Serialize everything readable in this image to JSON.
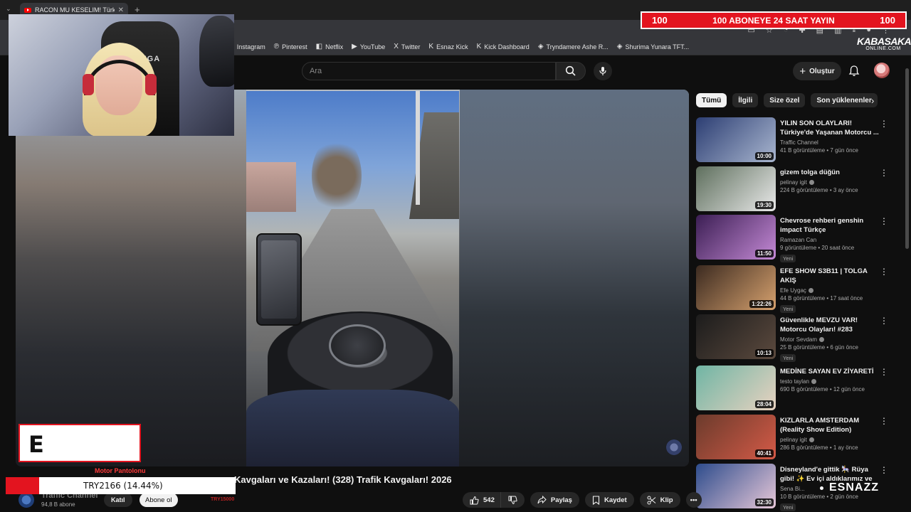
{
  "browser": {
    "tab_title": "RACON MU KESELIM! Türkiye'd",
    "new_tab_label": "+",
    "bookmarks": [
      {
        "label": "Instagram",
        "icon": "◎"
      },
      {
        "label": "Pinterest",
        "icon": "℗"
      },
      {
        "label": "Netflix",
        "icon": "◧"
      },
      {
        "label": "YouTube",
        "icon": "▶"
      },
      {
        "label": "Twitter",
        "icon": "X"
      },
      {
        "label": "Esnaz Kick",
        "icon": "K"
      },
      {
        "label": "Kick Dashboard",
        "icon": "K"
      },
      {
        "label": "Tryndamere Ashe R...",
        "icon": "◈"
      },
      {
        "label": "Shurima Yunara TFT...",
        "icon": "◈"
      }
    ]
  },
  "header": {
    "search_placeholder": "Ara",
    "create_label": "Oluştur"
  },
  "overlay": {
    "sub_left": "100",
    "sub_center": "100 ABONEYE 24 SAAT YAYIN",
    "sub_right": "100",
    "brand_top": "KABASAKAL",
    "brand_bottom": "ONLINE.COM",
    "chair_brand": "VEGA",
    "promo_letter": "E",
    "motor_label": "Motor Pantolonu",
    "try_text": "TRY2166 (14.44%)",
    "try_progress": 0.1444,
    "try_small": "TRY15000",
    "esnazz": "ESNAZZ"
  },
  "video": {
    "title": "Kavgaları ve Kazaları! (328) Trafik Kavgaları! 2026",
    "channel_name": "Traffic Channel",
    "channel_subs": "94,8 B abone",
    "join_label": "Katıl",
    "subscribe_label": "Abone ol",
    "likes": "542",
    "share_label": "Paylaş",
    "save_label": "Kaydet",
    "clip_label": "Klip"
  },
  "chips": [
    "Tümü",
    "İlgili",
    "Size özel",
    "Son yüklenenler"
  ],
  "related": [
    {
      "title": "YILIN SON OLAYLARI! Türkiye'de Yaşanan Motorcu ...",
      "channel": "Traffic Channel",
      "verified": false,
      "stats": "41 B görüntüleme • 7 gün önce",
      "duration": "10:00",
      "badge": "",
      "thumb_colors": [
        "#2c3e73",
        "#a9b6cf"
      ]
    },
    {
      "title": "gizem tolga düğün",
      "channel": "pelinay igit",
      "verified": true,
      "stats": "224 B görüntüleme • 3 ay önce",
      "duration": "19:30",
      "badge": "",
      "thumb_colors": [
        "#5e6f5d",
        "#e9e9e9"
      ]
    },
    {
      "title": "Chevrose rehberi genshin impact Türkçe",
      "channel": "Ramazan Can",
      "verified": false,
      "stats": "9 görüntüleme • 20 saat önce",
      "duration": "11:50",
      "badge": "Yeni",
      "thumb_colors": [
        "#3b1e53",
        "#c58ad6"
      ]
    },
    {
      "title": "EFE SHOW S3B11 | TOLGA AKIŞ",
      "channel": "Efe Uygaç",
      "verified": true,
      "stats": "44 B görüntüleme • 17 saat önce",
      "duration": "1:22:26",
      "badge": "Yeni",
      "thumb_colors": [
        "#3b2a20",
        "#d6a16e"
      ]
    },
    {
      "title": "Güvenlikle MEVZU VAR! Motorcu Olayları! #283",
      "channel": "Motor Sevdam",
      "verified": true,
      "stats": "25 B görüntüleme • 6 gün önce",
      "duration": "10:13",
      "badge": "Yeni",
      "thumb_colors": [
        "#1c1c1c",
        "#5c4a3e"
      ]
    },
    {
      "title": "MEDİNE SAYAN EV ZİYARETİ",
      "channel": "testo taylan",
      "verified": true,
      "stats": "690 B görüntüleme • 12 gün önce",
      "duration": "28:04",
      "badge": "",
      "thumb_colors": [
        "#6fb5a4",
        "#e8d2c0"
      ]
    },
    {
      "title": "KIZLARLA AMSTERDAM (Reality Show Edition)",
      "channel": "pelinay igit",
      "verified": true,
      "stats": "286 B görüntüleme • 1 ay önce",
      "duration": "40:41",
      "badge": "",
      "thumb_colors": [
        "#6b3b2c",
        "#d45a47"
      ]
    },
    {
      "title": "Disneyland'e gittik 🎠 Rüya gibi! ✨ Ev içi͏ aldıklarımız ve Japo...",
      "channel": "Sena Bi...",
      "verified": false,
      "stats": "10 B görüntüleme • 2 gün önce",
      "duration": "32:30",
      "badge": "Yeni",
      "thumb_colors": [
        "#2d4c8c",
        "#e7c7d8"
      ]
    }
  ]
}
